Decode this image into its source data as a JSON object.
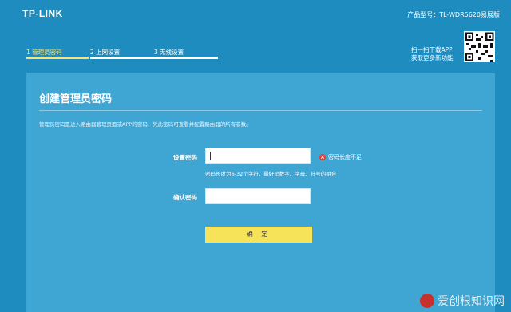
{
  "header": {
    "logo": "TP-LINK",
    "model": "产品型号：TL-WDR5620易展版"
  },
  "steps": [
    {
      "label": "1 管理员密码",
      "active": true
    },
    {
      "label": "2 上网设置",
      "active": false
    },
    {
      "label": "3 无线设置",
      "active": false
    }
  ],
  "app_download": {
    "line1": "扫一扫下载APP",
    "line2": "获取更多新功能"
  },
  "panel": {
    "title": "创建管理员密码",
    "description": "管理员密码是进入路由器管理页面或APP的密码，凭此密码可查看并配置路由器的所有参数。",
    "password_label": "设置密码",
    "password_value": "",
    "error_text": "密码长度不足",
    "hint": "密码长度为6-32个字符，最好是数字、字母、符号的组合",
    "confirm_label": "确认密码",
    "confirm_value": "",
    "confirm_button": "确 定"
  },
  "watermark": "爱创根知识网",
  "colors": {
    "background": "#1e8cbf",
    "panel": "#3fa6d4",
    "accent_yellow": "#f7e35a",
    "error_red": "#e23d2f"
  }
}
